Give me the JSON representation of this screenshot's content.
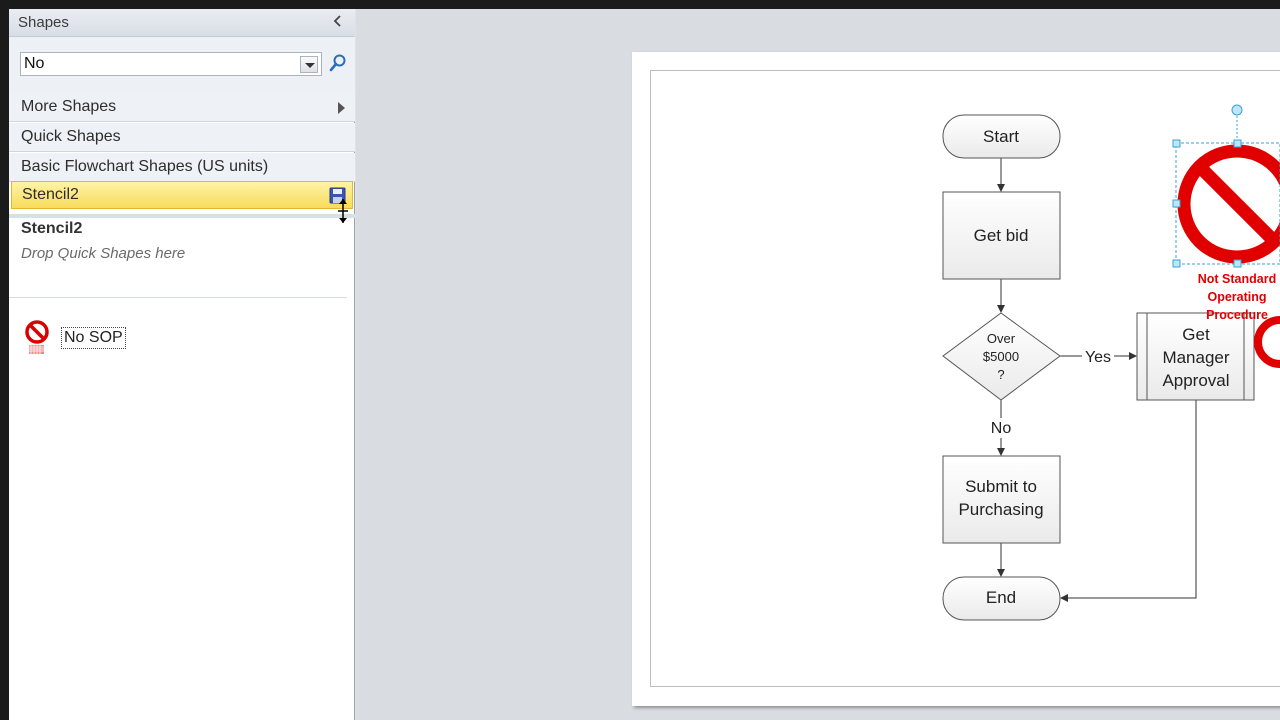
{
  "shapes_pane": {
    "title": "Shapes",
    "search_value": "No",
    "sections": [
      {
        "label": "More Shapes"
      },
      {
        "label": "Quick Shapes"
      },
      {
        "label": "Basic Flowchart Shapes (US units)"
      },
      {
        "label": "Stencil2"
      }
    ],
    "stencil": {
      "title": "Stencil2",
      "hint": "Drop Quick Shapes here",
      "masters": [
        {
          "label": "No SOP",
          "icon": "no-sop-icon"
        }
      ]
    }
  },
  "diagram": {
    "start": "Start",
    "get_bid": "Get bid",
    "decision_line1": "Over",
    "decision_line2": "$5000",
    "decision_line3": "?",
    "yes_label": "Yes",
    "no_label": "No",
    "approval_line1": "Get",
    "approval_line2": "Manager",
    "approval_line3": "Approval",
    "submit_line1": "Submit to",
    "submit_line2": "Purchasing",
    "end": "End",
    "no_sop_line1": "Not Standard",
    "no_sop_line2": "Operating",
    "no_sop_line3": "Procedure"
  },
  "colors": {
    "accent_red": "#e00000",
    "selection_blue": "#3aa0d8",
    "active_section": "#f8dc5c"
  }
}
